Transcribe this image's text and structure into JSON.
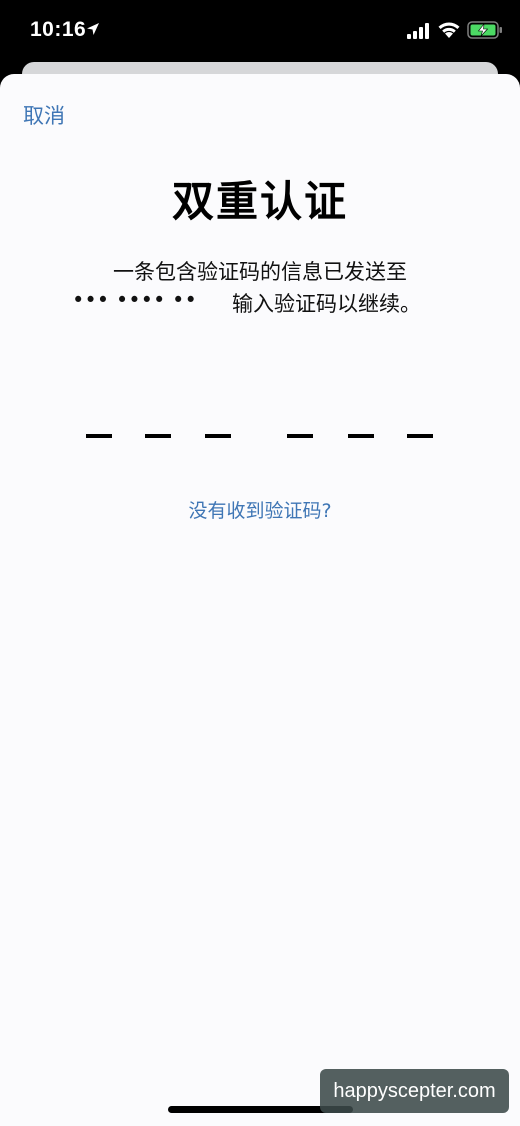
{
  "status_bar": {
    "time": "10:16",
    "icons": [
      "location-arrow-icon",
      "cellular-signal-icon",
      "wifi-icon",
      "battery-charging-icon"
    ],
    "battery_color": "#4cd964"
  },
  "sheet": {
    "cancel_label": "取消",
    "title": "双重认证",
    "message_line1": "一条包含验证码的信息已发送至",
    "masked_number": "••• •••• ••",
    "message_suffix": "输入验证码以继续。",
    "code_slots": [
      "",
      "",
      "",
      "",
      "",
      ""
    ],
    "resend_label": "没有收到验证码?"
  },
  "colors": {
    "accent": "#3f76b5",
    "sheet_background": "#fbfbfd"
  },
  "watermark": "happyscepter.com"
}
